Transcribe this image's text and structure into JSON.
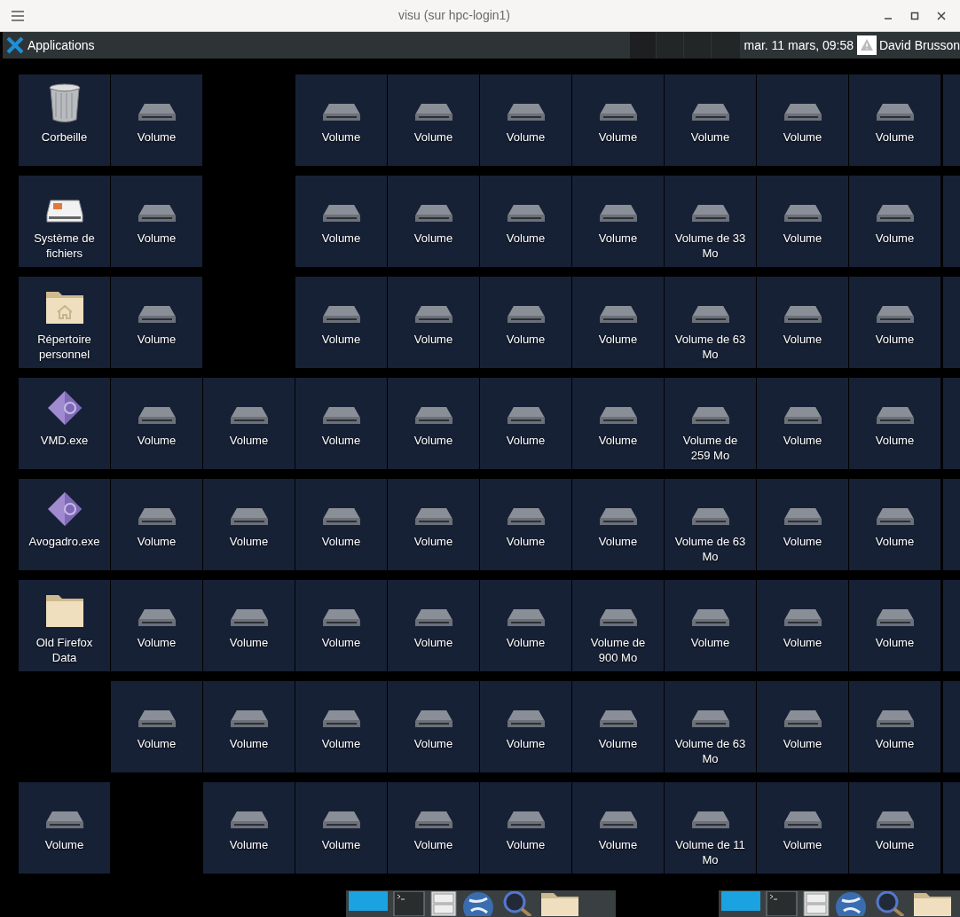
{
  "window": {
    "title": "visu (sur hpc-login1)"
  },
  "panel": {
    "menu_label": "Applications",
    "clock": "mar. 11 mars, 09:58",
    "user": "David Brusson"
  },
  "desktop": {
    "rows": [
      {
        "edge_tile": true,
        "cells": [
          {
            "kind": "trash",
            "label": "Corbeille"
          },
          {
            "kind": "volume",
            "label": "Volume"
          },
          null,
          {
            "kind": "volume",
            "label": "Volume"
          },
          {
            "kind": "volume",
            "label": "Volume"
          },
          {
            "kind": "volume",
            "label": "Volume"
          },
          {
            "kind": "volume",
            "label": "Volume"
          },
          {
            "kind": "volume",
            "label": "Volume"
          },
          {
            "kind": "volume",
            "label": "Volume"
          },
          {
            "kind": "volume",
            "label": "Volume"
          }
        ]
      },
      {
        "edge_tile": true,
        "cells": [
          {
            "kind": "drive",
            "label": "Système de fichiers"
          },
          {
            "kind": "volume",
            "label": "Volume"
          },
          null,
          {
            "kind": "volume",
            "label": "Volume"
          },
          {
            "kind": "volume",
            "label": "Volume"
          },
          {
            "kind": "volume",
            "label": "Volume"
          },
          {
            "kind": "volume",
            "label": "Volume"
          },
          {
            "kind": "volume",
            "label": "Volume de 33 Mo"
          },
          {
            "kind": "volume",
            "label": "Volume"
          },
          {
            "kind": "volume",
            "label": "Volume"
          }
        ]
      },
      {
        "edge_tile": true,
        "cells": [
          {
            "kind": "home",
            "label": "Répertoire personnel"
          },
          {
            "kind": "volume",
            "label": "Volume"
          },
          null,
          {
            "kind": "volume",
            "label": "Volume"
          },
          {
            "kind": "volume",
            "label": "Volume"
          },
          {
            "kind": "volume",
            "label": "Volume"
          },
          {
            "kind": "volume",
            "label": "Volume"
          },
          {
            "kind": "volume",
            "label": "Volume de 63 Mo"
          },
          {
            "kind": "volume",
            "label": "Volume"
          },
          {
            "kind": "volume",
            "label": "Volume"
          }
        ]
      },
      {
        "edge_tile": true,
        "cells": [
          {
            "kind": "app",
            "label": "VMD.exe"
          },
          {
            "kind": "volume",
            "label": "Volume"
          },
          {
            "kind": "volume",
            "label": "Volume"
          },
          {
            "kind": "volume",
            "label": "Volume"
          },
          {
            "kind": "volume",
            "label": "Volume"
          },
          {
            "kind": "volume",
            "label": "Volume"
          },
          {
            "kind": "volume",
            "label": "Volume"
          },
          {
            "kind": "volume",
            "label": "Volume de 259 Mo"
          },
          {
            "kind": "volume",
            "label": "Volume"
          },
          {
            "kind": "volume",
            "label": "Volume"
          }
        ]
      },
      {
        "edge_tile": true,
        "cells": [
          {
            "kind": "app",
            "label": "Avogadro.exe"
          },
          {
            "kind": "volume",
            "label": "Volume"
          },
          {
            "kind": "volume",
            "label": "Volume"
          },
          {
            "kind": "volume",
            "label": "Volume"
          },
          {
            "kind": "volume",
            "label": "Volume"
          },
          {
            "kind": "volume",
            "label": "Volume"
          },
          {
            "kind": "volume",
            "label": "Volume"
          },
          {
            "kind": "volume",
            "label": "Volume de 63 Mo"
          },
          {
            "kind": "volume",
            "label": "Volume"
          },
          {
            "kind": "volume",
            "label": "Volume"
          }
        ]
      },
      {
        "edge_tile": true,
        "cells": [
          {
            "kind": "folder",
            "label": "Old Firefox Data"
          },
          {
            "kind": "volume",
            "label": "Volume"
          },
          {
            "kind": "volume",
            "label": "Volume"
          },
          {
            "kind": "volume",
            "label": "Volume"
          },
          {
            "kind": "volume",
            "label": "Volume"
          },
          {
            "kind": "volume",
            "label": "Volume"
          },
          {
            "kind": "volume",
            "label": "Volume de 900 Mo"
          },
          {
            "kind": "volume",
            "label": "Volume"
          },
          {
            "kind": "volume",
            "label": "Volume"
          },
          {
            "kind": "volume",
            "label": "Volume"
          }
        ]
      },
      {
        "edge_tile": true,
        "cells": [
          null,
          {
            "kind": "volume",
            "label": "Volume"
          },
          {
            "kind": "volume",
            "label": "Volume"
          },
          {
            "kind": "volume",
            "label": "Volume"
          },
          {
            "kind": "volume",
            "label": "Volume"
          },
          {
            "kind": "volume",
            "label": "Volume"
          },
          {
            "kind": "volume",
            "label": "Volume"
          },
          {
            "kind": "volume",
            "label": "Volume de 63 Mo"
          },
          {
            "kind": "volume",
            "label": "Volume"
          },
          {
            "kind": "volume",
            "label": "Volume"
          }
        ]
      },
      {
        "edge_tile": true,
        "cells": [
          {
            "kind": "volume",
            "label": "Volume"
          },
          null,
          {
            "kind": "volume",
            "label": "Volume"
          },
          {
            "kind": "volume",
            "label": "Volume"
          },
          {
            "kind": "volume",
            "label": "Volume"
          },
          {
            "kind": "volume",
            "label": "Volume"
          },
          {
            "kind": "volume",
            "label": "Volume"
          },
          {
            "kind": "volume",
            "label": "Volume de 11 Mo"
          },
          {
            "kind": "volume",
            "label": "Volume"
          },
          {
            "kind": "volume",
            "label": "Volume"
          }
        ]
      }
    ]
  }
}
